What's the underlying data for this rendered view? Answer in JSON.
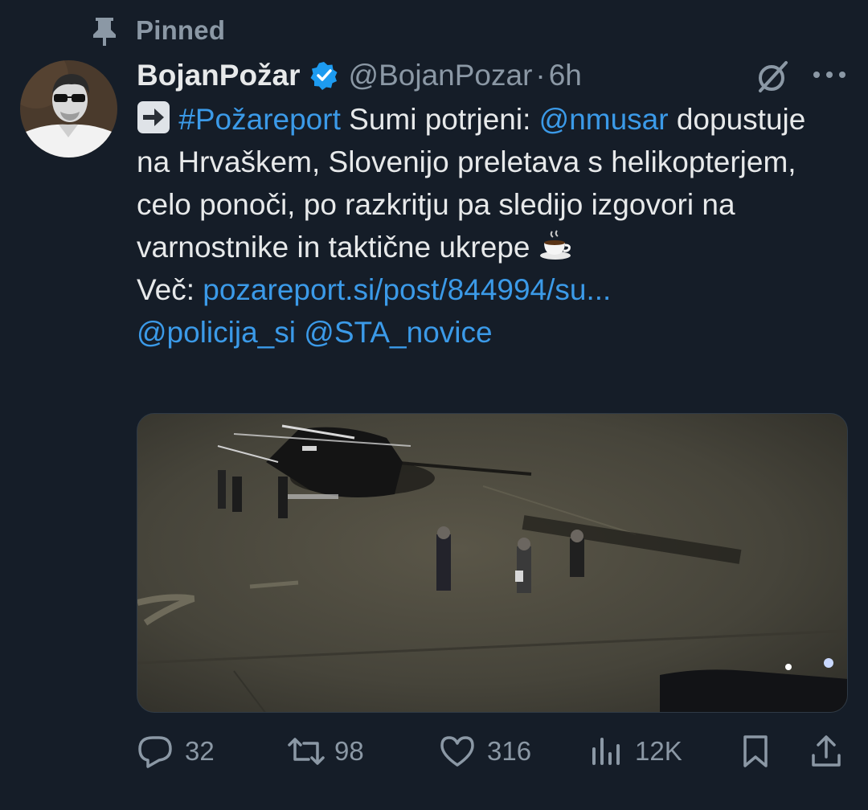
{
  "pinned": {
    "label": "Pinned",
    "icon": "pin-icon"
  },
  "author": {
    "display_name": "BojanPožar",
    "handle": "@BojanPozar",
    "separator": "·",
    "time": "6h",
    "verified": true,
    "avatar_icon": "avatar"
  },
  "tweet": {
    "arrow_emoji": "➡️",
    "hashtag": "#Požareport",
    "text_1": " Sumi potrjeni: ",
    "mention_1": "@nmusar",
    "text_2": "dopustuje na Hrvaškem, Slovenijo preletava s helikopterjem, celo ponoči, po razkritju pa sledijo izgovori na varnostnike in taktične ukrepe",
    "coffee_emoji": "☕",
    "more_label": "Več: ",
    "link": "pozareport.si/post/844994/su...",
    "mention_2": "@policija_si",
    "mention_3": "@STA_novice"
  },
  "media": {
    "type": "photo",
    "subject": "helicopter-at-night"
  },
  "actions": {
    "replies": "32",
    "retweets": "98",
    "likes": "316",
    "views": "12K"
  },
  "colors": {
    "background": "#151d28",
    "text": "#e7e9ea",
    "secondary": "#8b98a5",
    "link": "#3b9ae8",
    "verified": "#1d9bf0"
  }
}
